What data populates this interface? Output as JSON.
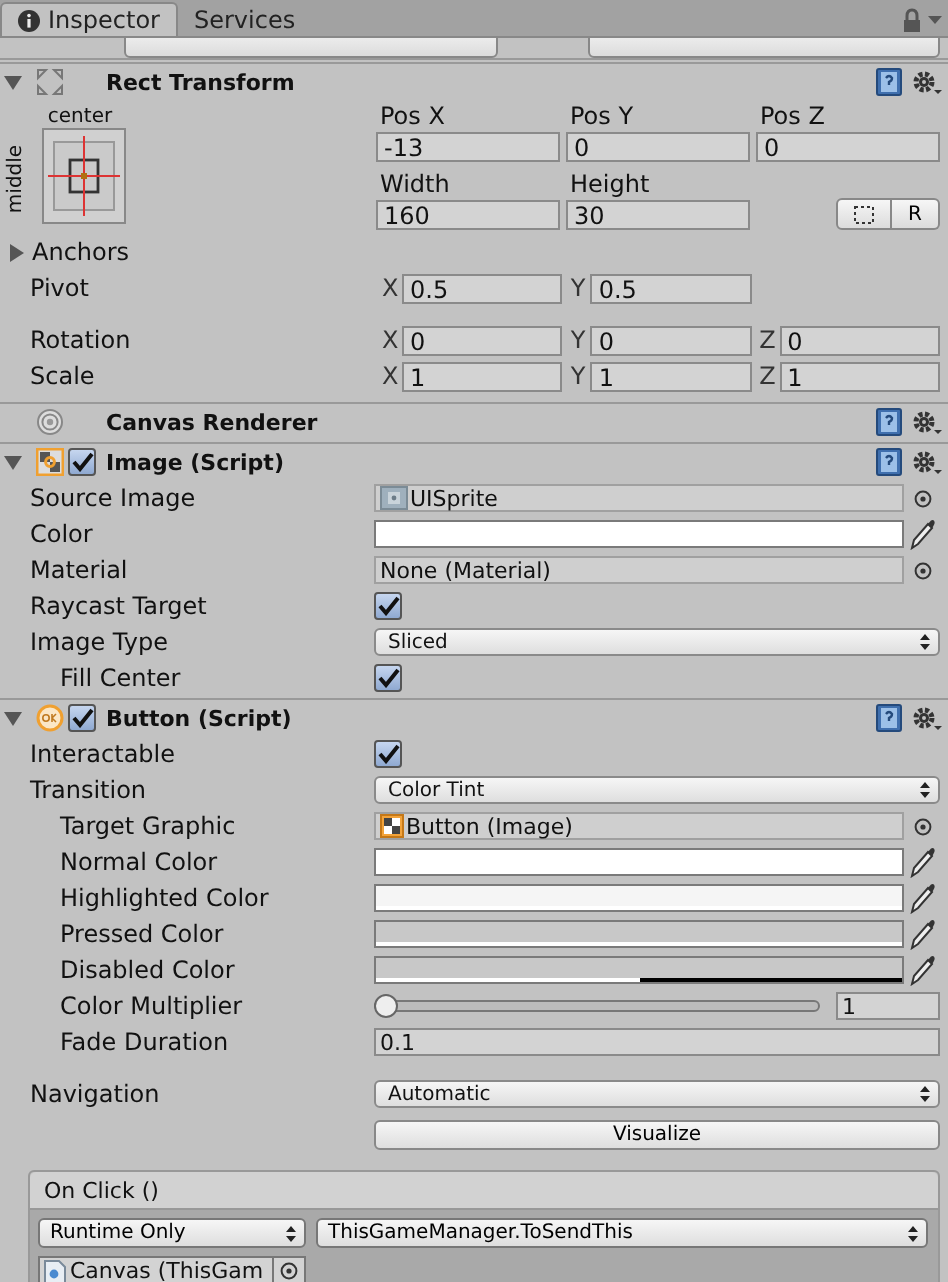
{
  "tabs": [
    {
      "label": "Inspector",
      "selected": true
    },
    {
      "label": "Services",
      "selected": false
    }
  ],
  "components": [
    {
      "kind": "rect",
      "title": "Rect Transform",
      "expanded": true,
      "anchor_h": "center",
      "anchor_v": "middle",
      "pos": [
        {
          "label": "Pos X",
          "value": "-13"
        },
        {
          "label": "Pos Y",
          "value": "0"
        },
        {
          "label": "Pos Z",
          "value": "0"
        }
      ],
      "size": [
        {
          "label": "Width",
          "value": "160"
        },
        {
          "label": "Height",
          "value": "30"
        }
      ],
      "raw_button": "R",
      "anchors": {
        "label": "Anchors",
        "expanded": false
      },
      "pivot": {
        "label": "Pivot",
        "axes": [
          {
            "axis": "X",
            "value": "0.5"
          },
          {
            "axis": "Y",
            "value": "0.5"
          }
        ]
      },
      "vector_rows": [
        {
          "label": "Rotation",
          "axes": [
            {
              "axis": "X",
              "value": "0"
            },
            {
              "axis": "Y",
              "value": "0"
            },
            {
              "axis": "Z",
              "value": "0"
            }
          ]
        },
        {
          "label": "Scale",
          "axes": [
            {
              "axis": "X",
              "value": "1"
            },
            {
              "axis": "Y",
              "value": "1"
            },
            {
              "axis": "Z",
              "value": "1"
            }
          ]
        }
      ]
    },
    {
      "kind": "plain",
      "title": "Canvas Renderer"
    },
    {
      "kind": "image",
      "title": "Image (Script)",
      "expanded": true,
      "enabled": true,
      "fields": [
        {
          "label": "Source Image",
          "kind": "sprite",
          "value": "UISprite"
        },
        {
          "label": "Color",
          "kind": "color",
          "color": "#ffffff",
          "level": 1
        },
        {
          "label": "Material",
          "kind": "object",
          "value": "None (Material)"
        },
        {
          "label": "Raycast Target",
          "kind": "check",
          "checked": true
        },
        {
          "label": "Image Type",
          "kind": "dropdown",
          "value": "Sliced",
          "children": [
            {
              "label": "Fill Center",
              "kind": "check",
              "checked": true
            }
          ]
        }
      ]
    },
    {
      "kind": "button",
      "title": "Button (Script)",
      "expanded": true,
      "enabled": true,
      "fields": [
        {
          "label": "Interactable",
          "kind": "check",
          "checked": true
        },
        {
          "label": "Transition",
          "kind": "dropdown",
          "value": "Color Tint",
          "children": [
            {
              "label": "Target Graphic",
              "kind": "reference",
              "value": "Button (Image)"
            },
            {
              "label": "Normal Color",
              "kind": "color",
              "color": "#ffffff",
              "level": 1
            },
            {
              "label": "Highlighted Color",
              "kind": "color",
              "color": "#f5f5f5",
              "level": 1
            },
            {
              "label": "Pressed Color",
              "kind": "color",
              "color": "#c8c8c8",
              "level": 1
            },
            {
              "label": "Disabled Color",
              "kind": "color",
              "color": "#c8c8c8",
              "level": 0.5
            },
            {
              "label": "Color Multiplier",
              "kind": "slider",
              "level": 0,
              "value": "1"
            },
            {
              "label": "Fade Duration",
              "kind": "text",
              "value": "0.1"
            }
          ]
        }
      ],
      "navigation": {
        "label": "Navigation",
        "value": "Automatic",
        "button": "Visualize"
      },
      "event": {
        "title": "On Click ()",
        "runtime": "Runtime Only",
        "function": "ThisGameManager.ToSendThis",
        "target": "Canvas (ThisGam"
      }
    }
  ]
}
